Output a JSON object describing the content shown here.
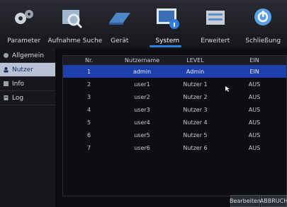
{
  "nav": {
    "items": [
      {
        "label": "Parameter",
        "icon": "gears-icon"
      },
      {
        "label": "Aufnahme Suche",
        "icon": "magnifier-icon"
      },
      {
        "label": "Gerät",
        "icon": "hard-drive-icon"
      },
      {
        "label": "System",
        "icon": "system-info-icon"
      },
      {
        "label": "Erweitert",
        "icon": "advanced-icon"
      },
      {
        "label": "Schließung",
        "icon": "power-icon"
      }
    ],
    "active": "System"
  },
  "sidebar": {
    "items": [
      {
        "label": "Allgemein",
        "icon": "general-icon"
      },
      {
        "label": "Nutzer",
        "icon": "user-icon"
      },
      {
        "label": "Info",
        "icon": "info-icon"
      },
      {
        "label": "Log",
        "icon": "log-icon"
      }
    ],
    "active": "Nutzer"
  },
  "table": {
    "headers": [
      "Nr.",
      "Nutzername",
      "LEVEL",
      "EIN"
    ],
    "rows": [
      [
        "1",
        "admin",
        "Admin",
        "EIN"
      ],
      [
        "2",
        "user1",
        "Nutzer 1",
        "AUS"
      ],
      [
        "3",
        "user2",
        "Nutzer 2",
        "AUS"
      ],
      [
        "4",
        "user3",
        "Nutzer 3",
        "AUS"
      ],
      [
        "5",
        "user4",
        "Nutzer 4",
        "AUS"
      ],
      [
        "6",
        "user5",
        "Nutzer 5",
        "AUS"
      ],
      [
        "7",
        "user6",
        "Nutzer 6",
        "AUS"
      ]
    ],
    "selected_row": 0
  },
  "buttons": {
    "edit": "Bearbeiten",
    "cancel": "ABBRUCH"
  },
  "colors": {
    "background": "#0d0e12",
    "selection": "#1d3fae",
    "accent": "#2f7fe0",
    "sidebar_active": "#b8c2d4"
  }
}
